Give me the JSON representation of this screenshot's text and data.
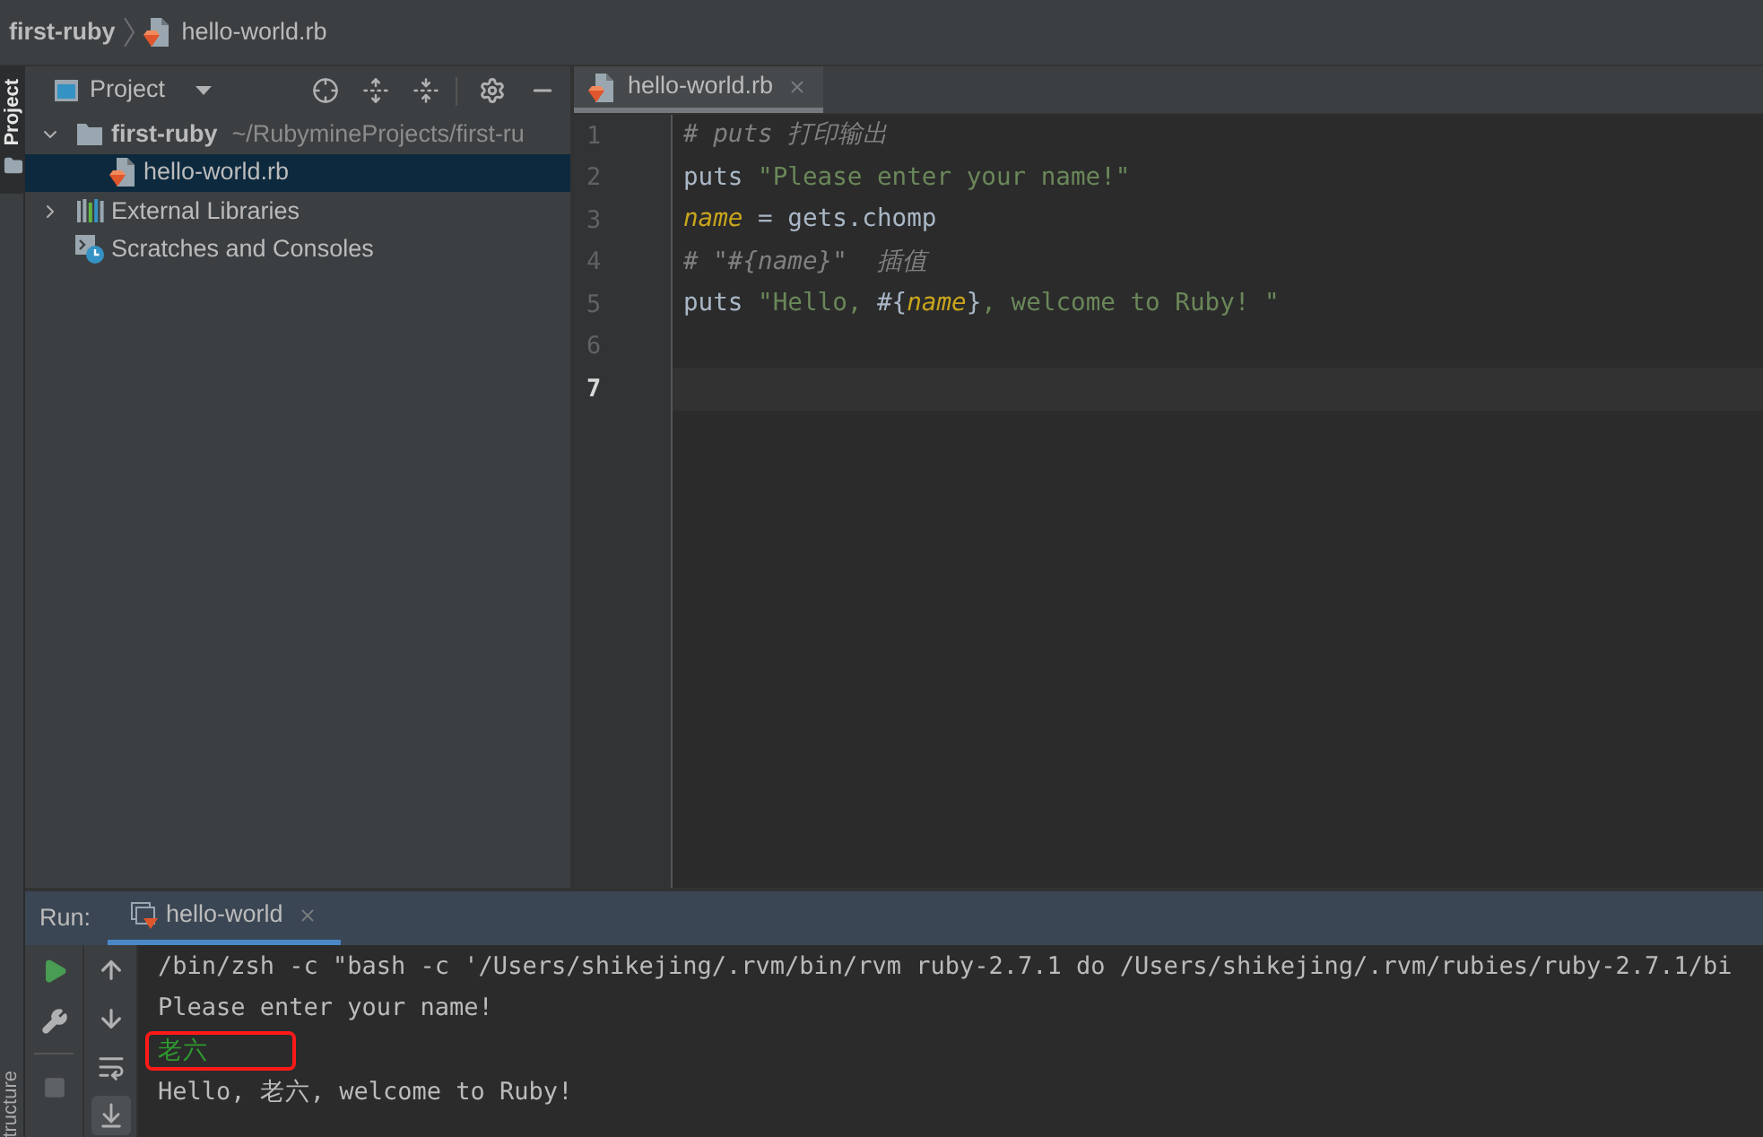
{
  "breadcrumb": [
    {
      "kind": "folder",
      "label": "first-ruby"
    },
    {
      "kind": "ruby-file",
      "label": "hello-world.rb"
    }
  ],
  "side_strip": {
    "tabs": [
      {
        "label": "Project",
        "selected": true
      }
    ],
    "bottom_label": "tructure"
  },
  "project_panel": {
    "view": "Project",
    "tree": [
      {
        "kind": "folder",
        "label": "first-ruby",
        "path": "~/RubymineProjects/first-ru",
        "expanded": true,
        "selected": false,
        "children": [
          {
            "kind": "ruby-file",
            "label": "hello-world.rb",
            "selected": true
          }
        ]
      },
      {
        "kind": "libraries",
        "label": "External Libraries",
        "expanded": false,
        "selected": false
      },
      {
        "kind": "scratches",
        "label": "Scratches and Consoles",
        "selected": false
      }
    ]
  },
  "editor": {
    "tabs": [
      {
        "label": "hello-world.rb",
        "selected": true
      }
    ],
    "lines": [
      {
        "number": "1",
        "current": false,
        "tokens": [
          {
            "kind": "comment",
            "text": "# puts 打印输出"
          }
        ]
      },
      {
        "number": "2",
        "current": false,
        "tokens": [
          {
            "kind": "plain",
            "text": "puts "
          },
          {
            "kind": "string",
            "text": "\"Please enter your name!\""
          }
        ]
      },
      {
        "number": "3",
        "current": false,
        "tokens": [
          {
            "kind": "variable",
            "text": "name"
          },
          {
            "kind": "plain",
            "text": " = gets.chomp"
          }
        ]
      },
      {
        "number": "4",
        "current": false,
        "tokens": [
          {
            "kind": "comment",
            "text": "# \"#{name}\"  插值"
          }
        ]
      },
      {
        "number": "5",
        "current": false,
        "tokens": [
          {
            "kind": "plain",
            "text": "puts "
          },
          {
            "kind": "string",
            "text": "\"Hello, "
          },
          {
            "kind": "plain",
            "text": "#{"
          },
          {
            "kind": "variable",
            "text": "name"
          },
          {
            "kind": "plain",
            "text": "}"
          },
          {
            "kind": "string",
            "text": ", welcome to Ruby! \""
          }
        ]
      },
      {
        "number": "6",
        "current": false
      },
      {
        "number": "7",
        "current": true
      }
    ]
  },
  "run_panel": {
    "title": "Run:",
    "tabs": [
      {
        "label": "hello-world",
        "selected": true
      }
    ],
    "side_tools": [
      {
        "kind": "rerun",
        "disabled": false
      },
      {
        "kind": "settings",
        "disabled": false
      },
      {
        "kind": "stop",
        "disabled": true
      }
    ],
    "nav_tools": [
      {
        "kind": "up",
        "on": false
      },
      {
        "kind": "down",
        "on": false
      },
      {
        "kind": "wrap",
        "on": false
      },
      {
        "kind": "scroll-end",
        "on": true
      }
    ],
    "console": [
      {
        "kind": "command",
        "text": "/bin/zsh -c \"bash -c '/Users/shikejing/.rvm/bin/rvm ruby-2.7.1 do /Users/shikejing/.rvm/rubies/ruby-2.7.1/bi",
        "highlighted": false
      },
      {
        "kind": "output",
        "text": "Please enter your name!",
        "highlighted": false
      },
      {
        "kind": "input",
        "text": "老六",
        "highlighted": true
      },
      {
        "kind": "output",
        "text": "Hello, 老六, welcome to Ruby!",
        "highlighted": false
      }
    ]
  }
}
